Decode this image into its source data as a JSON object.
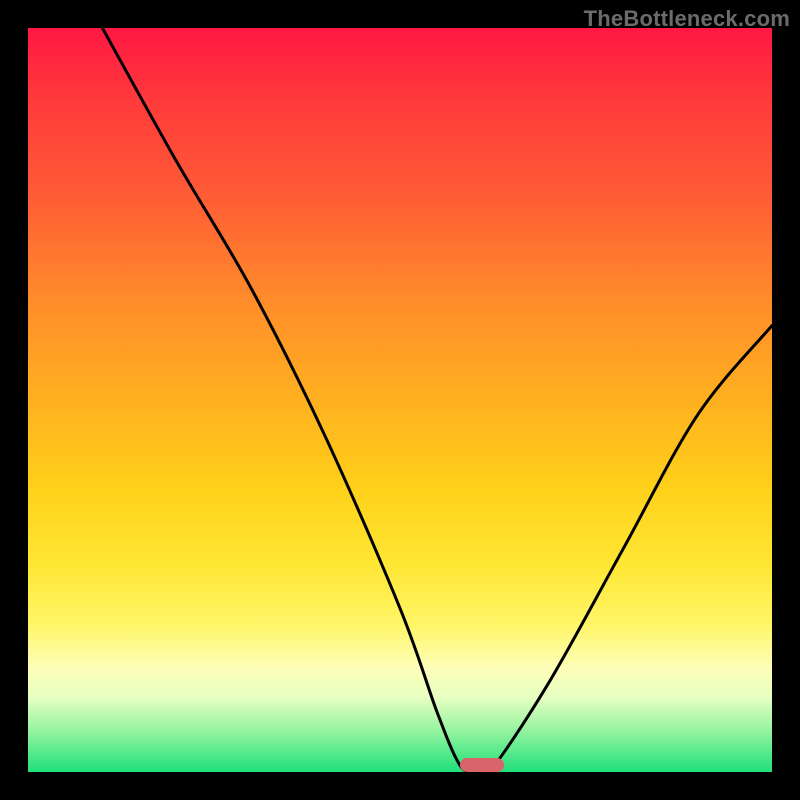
{
  "watermark": "TheBottleneck.com",
  "colors": {
    "frame": "#000000",
    "gradient_top": "#ff1744",
    "gradient_bottom": "#1fe07a",
    "curve_stroke": "#000000",
    "marker_fill": "#d9646b"
  },
  "chart_data": {
    "type": "line",
    "title": "",
    "xlabel": "",
    "ylabel": "",
    "xlim": [
      0,
      100
    ],
    "ylim": [
      0,
      100
    ],
    "grid": false,
    "legend": false,
    "series": [
      {
        "name": "bottleneck-curve",
        "x": [
          10,
          20,
          30,
          40,
          50,
          55,
          58,
          60,
          62,
          70,
          80,
          90,
          100
        ],
        "y": [
          100,
          82,
          65,
          45,
          22,
          8,
          1,
          0,
          0,
          12,
          30,
          48,
          60
        ]
      }
    ],
    "marker": {
      "x_range": [
        58,
        64
      ],
      "y": 0
    }
  }
}
